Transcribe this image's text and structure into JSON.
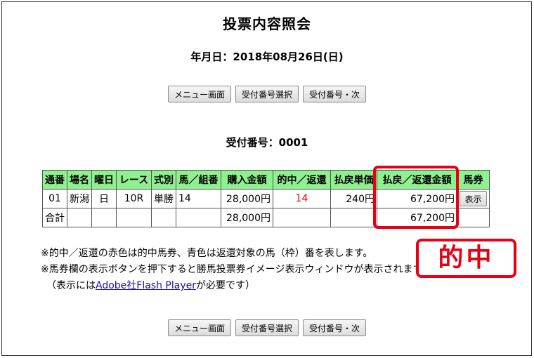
{
  "page": {
    "title": "投票内容照会",
    "date_label": "年月日：2018年08月26日(日)",
    "receipt_label": "受付番号：0001"
  },
  "buttons": {
    "menu": "メニュー画面",
    "receipt_select": "受付番号選択",
    "receipt_next": "受付番号・次"
  },
  "table": {
    "headers": [
      "通番",
      "場名",
      "曜日",
      "レース",
      "式別",
      "馬／組番",
      "購入金額",
      "的中／返還",
      "払戻単価",
      "払戻／返還金額",
      "馬券"
    ],
    "row": {
      "seq": "01",
      "venue": "新潟",
      "weekday": "日",
      "race": "10R",
      "bet_type": "単勝",
      "horse": "14",
      "purchase": "28,000円",
      "hit": "14",
      "unit_payout": "240円",
      "payout_total": "67,200円",
      "show_button": "表示"
    },
    "total": {
      "label": "合計",
      "purchase": "28,000円",
      "payout_total": "67,200円"
    }
  },
  "notes": {
    "line1": "※的中／返還の赤色は的中馬券、青色は返還対象の馬（枠）番を表します。",
    "line2": "※馬券欄の表示ボタンを押下すると勝馬投票券イメージ表示ウィンドウが表示されます。",
    "line3_pre": "（表示には",
    "line3_link": "Adobe社Flash Player",
    "line3_post": "が必要です）"
  },
  "annotation": {
    "badge": "的中",
    "color": "#e60012"
  },
  "colors": {
    "header_bg": "#8ef08e",
    "hit_text": "#e00000",
    "link": "#1a0dab"
  }
}
